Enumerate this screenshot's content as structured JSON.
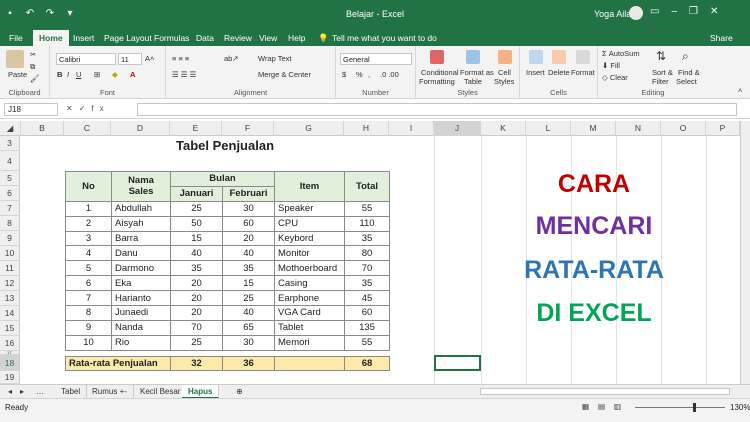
{
  "window": {
    "title": "Belajar - Excel",
    "user": "Yoga Ailala",
    "share": "Share"
  },
  "tabs": [
    "File",
    "Home",
    "Insert",
    "Page Layout",
    "Formulas",
    "Data",
    "Review",
    "View",
    "Help",
    "Tell me what you want to do"
  ],
  "ribbon": {
    "clipboard": {
      "label": "Clipboard",
      "paste": "Paste"
    },
    "font": {
      "label": "Font",
      "name": "Calibri",
      "size": "11",
      "bold": "B",
      "italic": "I",
      "underline": "U"
    },
    "alignment": {
      "label": "Alignment",
      "wrap": "Wrap Text",
      "merge": "Merge & Center"
    },
    "number": {
      "label": "Number",
      "format": "General",
      "currency": "$",
      "percent": "%",
      "comma": ","
    },
    "styles": {
      "label": "Styles",
      "conditional": "Conditional",
      "formatting": "Formatting",
      "format_as": "Format as",
      "table": "Table",
      "cell": "Cell",
      "cell_styles": "Styles"
    },
    "cells": {
      "label": "Cells",
      "insert": "Insert",
      "delete": "Delete",
      "format": "Format"
    },
    "editing": {
      "label": "Editing",
      "autosum": "AutoSum",
      "fill": "Fill",
      "clear": "Clear",
      "sort": "Sort &",
      "filter": "Filter",
      "find": "Find &",
      "select": "Select"
    }
  },
  "formula_bar": {
    "name_box": "J18",
    "fx": "fx",
    "value": ""
  },
  "columns": [
    "B",
    "C",
    "D",
    "E",
    "F",
    "G",
    "H",
    "I",
    "J",
    "K",
    "L",
    "M",
    "N",
    "O",
    "P"
  ],
  "rows": [
    "3",
    "4",
    "5",
    "6",
    "7",
    "8",
    "9",
    "10",
    "11",
    "12",
    "13",
    "14",
    "15",
    "16",
    "17",
    "18",
    "19"
  ],
  "sheet": {
    "table_title": "Tabel Penjualan",
    "headers": {
      "no": "No",
      "nama": "Nama Sales",
      "bulan": "Bulan",
      "januari": "Januari",
      "februari": "Februari",
      "item": "Item",
      "total": "Total"
    },
    "records": [
      {
        "no": "1",
        "nama": "Abdullah",
        "jan": "25",
        "feb": "30",
        "item": "Speaker",
        "total": "55"
      },
      {
        "no": "2",
        "nama": "Aisyah",
        "jan": "50",
        "feb": "60",
        "item": "CPU",
        "total": "110"
      },
      {
        "no": "3",
        "nama": "Barra",
        "jan": "15",
        "feb": "20",
        "item": "Keybord",
        "total": "35"
      },
      {
        "no": "4",
        "nama": "Danu",
        "jan": "40",
        "feb": "40",
        "item": "Monitor",
        "total": "80"
      },
      {
        "no": "5",
        "nama": "Darmono",
        "jan": "35",
        "feb": "35",
        "item": "Mothoerboard",
        "total": "70"
      },
      {
        "no": "6",
        "nama": "Eka",
        "jan": "20",
        "feb": "15",
        "item": "Casing",
        "total": "35"
      },
      {
        "no": "7",
        "nama": "Harianto",
        "jan": "20",
        "feb": "25",
        "item": "Earphone",
        "total": "45"
      },
      {
        "no": "8",
        "nama": "Junaedi",
        "jan": "20",
        "feb": "40",
        "item": "VGA Card",
        "total": "60"
      },
      {
        "no": "9",
        "nama": "Nanda",
        "jan": "70",
        "feb": "65",
        "item": "Tablet",
        "total": "135"
      },
      {
        "no": "10",
        "nama": "Rio",
        "jan": "25",
        "feb": "30",
        "item": "Memori",
        "total": "55"
      }
    ],
    "average": {
      "label": "Rata-rata Penjualan",
      "jan": "32",
      "feb": "36",
      "total": "68"
    }
  },
  "overlay": {
    "line1": "CARA",
    "line2": "MENCARI",
    "line3": "RATA-RATA",
    "line4": "DI EXCEL",
    "colors": {
      "line1": "#c00000",
      "line2": "#7030a0",
      "line3": "#2e75b6",
      "line4": "#00a651"
    }
  },
  "sheet_tabs": [
    "Tabel",
    "Rumus +-",
    "Kecil Besar",
    "Hapus"
  ],
  "status": {
    "ready": "Ready",
    "zoom": "130%"
  }
}
